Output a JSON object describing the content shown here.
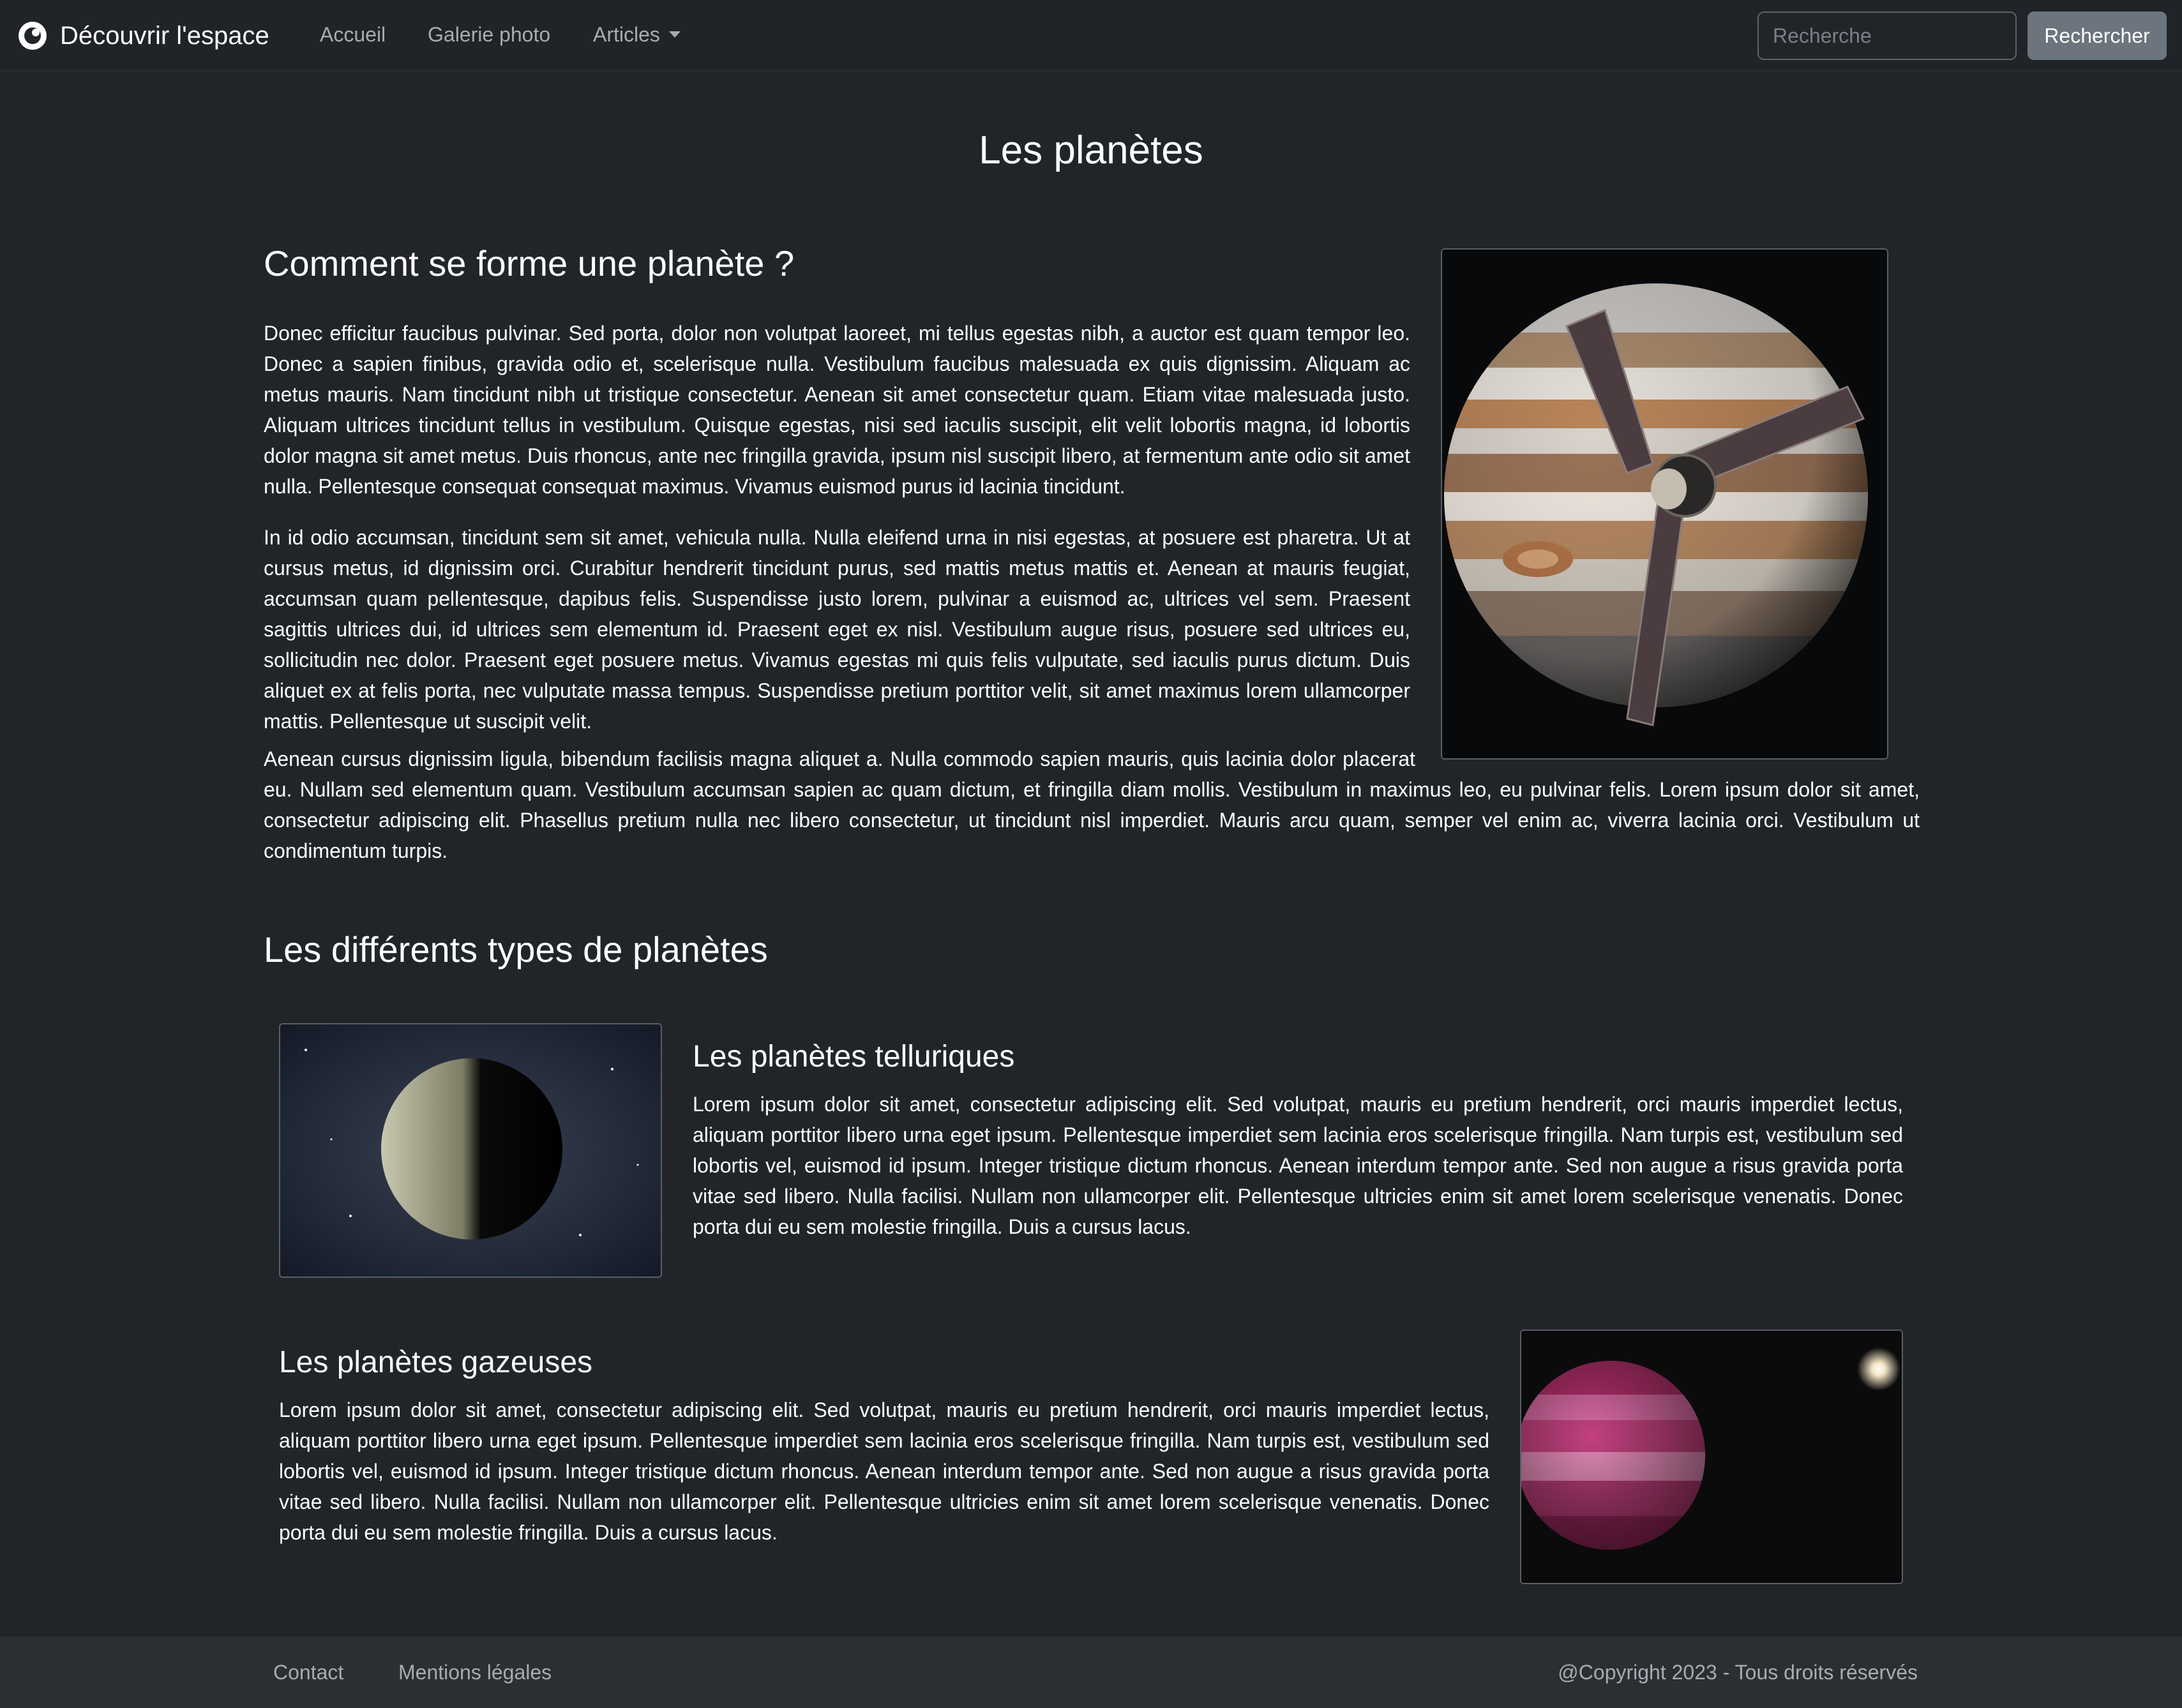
{
  "navbar": {
    "brand": "Découvrir l'espace",
    "links": [
      "Accueil",
      "Galerie photo",
      "Articles"
    ],
    "search_placeholder": "Recherche",
    "search_button": "Rechercher"
  },
  "main": {
    "page_title": "Les planètes",
    "section1": {
      "title": "Comment se forme une planète ?",
      "paragraphs": [
        "Donec efficitur faucibus pulvinar. Sed porta, dolor non volutpat laoreet, mi tellus egestas nibh, a auctor est quam tempor leo. Donec a sapien finibus, gravida odio et, scelerisque nulla. Vestibulum faucibus malesuada ex quis dignissim. Aliquam ac metus mauris. Nam tincidunt nibh ut tristique consectetur. Aenean sit amet consectetur quam. Etiam vitae malesuada justo. Aliquam ultrices tincidunt tellus in vestibulum. Quisque egestas, nisi sed iaculis suscipit, elit velit lobortis magna, id lobortis dolor magna sit amet metus. Duis rhoncus, ante nec fringilla gravida, ipsum nisl suscipit libero, at fermentum ante odio sit amet nulla. Pellentesque consequat consequat maximus. Vivamus euismod purus id lacinia tincidunt.",
        "In id odio accumsan, tincidunt sem sit amet, vehicula nulla. Nulla eleifend urna in nisi egestas, at posuere est pharetra. Ut at cursus metus, id dignissim orci. Curabitur hendrerit tincidunt purus, sed mattis metus mattis et. Aenean at mauris feugiat, accumsan quam pellentesque, dapibus felis. Suspendisse justo lorem, pulvinar a euismod ac, ultrices vel sem. Praesent sagittis ultrices dui, id ultrices sem elementum id. Praesent eget ex nisl. Vestibulum augue risus, posuere sed ultrices eu, sollicitudin nec dolor. Praesent eget posuere metus. Vivamus egestas mi quis felis vulputate, sed iaculis purus dictum. Duis aliquet ex at felis porta, nec vulputate massa tempus. Suspendisse pretium porttitor velit, sit amet maximus lorem ullamcorper mattis. Pellentesque ut suscipit velit.",
        "Aenean cursus dignissim ligula, bibendum facilisis magna aliquet a. Nulla commodo sapien mauris, quis lacinia dolor placerat eu. Nullam sed elementum quam. Vestibulum accumsan sapien ac quam dictum, et fringilla diam mollis. Vestibulum in maximus leo, eu pulvinar felis. Lorem ipsum dolor sit amet, consectetur adipiscing elit. Phasellus pretium nulla nec libero consectetur, ut tincidunt nisl imperdiet. Mauris arcu quam, semper vel enim ac, viverra lacinia orci. Vestibulum ut condimentum turpis."
      ]
    },
    "section2": {
      "title": "Les différents types de planètes",
      "cards": [
        {
          "title": "Les planètes telluriques",
          "text": "Lorem ipsum dolor sit amet, consectetur adipiscing elit. Sed volutpat, mauris eu pretium hendrerit, orci mauris imperdiet lectus, aliquam porttitor libero urna eget ipsum. Pellentesque imperdiet sem lacinia eros scelerisque fringilla. Nam turpis est, vestibulum sed lobortis vel, euismod id ipsum. Integer tristique dictum rhoncus. Aenean interdum tempor ante. Sed non augue a risus gravida porta vitae sed libero. Nulla facilisi. Nullam non ullamcorper elit. Pellentesque ultricies enim sit amet lorem scelerisque venenatis. Donec porta dui eu sem molestie fringilla. Duis a cursus lacus."
        },
        {
          "title": "Les planètes gazeuses",
          "text": "Lorem ipsum dolor sit amet, consectetur adipiscing elit. Sed volutpat, mauris eu pretium hendrerit, orci mauris imperdiet lectus, aliquam porttitor libero urna eget ipsum. Pellentesque imperdiet sem lacinia eros scelerisque fringilla. Nam turpis est, vestibulum sed lobortis vel, euismod id ipsum. Integer tristique dictum rhoncus. Aenean interdum tempor ante. Sed non augue a risus gravida porta vitae sed libero. Nulla facilisi. Nullam non ullamcorper elit. Pellentesque ultricies enim sit amet lorem scelerisque venenatis. Donec porta dui eu sem molestie fringilla. Duis a cursus lacus."
        }
      ]
    }
  },
  "footer": {
    "links": [
      "Contact",
      "Mentions légales"
    ],
    "copyright": "@Copyright 2023 - Tous droits réservés"
  },
  "colors": {
    "background": "#212529",
    "navbar": "#202327",
    "footer": "#2b2e33",
    "muted_text": "#a7acb1",
    "button": "#6c757d",
    "gas_planet": "#c2417e"
  }
}
